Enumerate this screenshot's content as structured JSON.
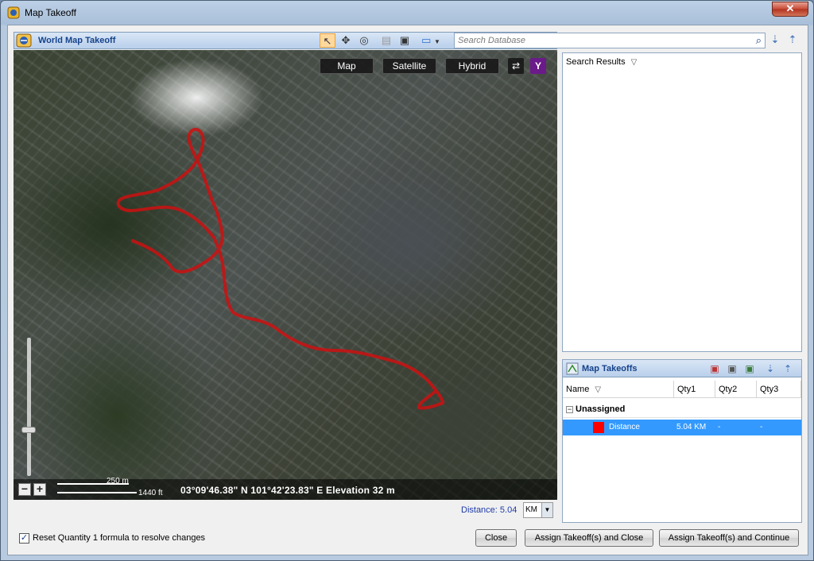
{
  "window": {
    "title": "Map Takeoff",
    "close_glyph": "✕"
  },
  "left_header": {
    "title": "World Map Takeoff"
  },
  "search": {
    "placeholder": "Search Database"
  },
  "map": {
    "view_buttons": [
      "Map",
      "Satellite",
      "Hybrid"
    ],
    "coordinates": "03°09'46.38\" N  101°42'23.83\" E  Elevation 32 m",
    "scale_meters": "250 m",
    "scale_feet": "1440 ft",
    "zoom_in": "+",
    "zoom_out": "−",
    "route_color": "#cc1111"
  },
  "distance": {
    "label": "Distance: 5.04",
    "unit": "KM"
  },
  "search_results": {
    "title": "Search Results"
  },
  "takeoffs": {
    "title": "Map Takeoffs",
    "columns": [
      "Name",
      "Qty1",
      "Qty2",
      "Qty3"
    ],
    "group": "Unassigned",
    "rows": [
      {
        "name": "Distance",
        "qty1": "5.04 KM",
        "qty2": "-",
        "qty3": "-",
        "color": "#ff0000"
      }
    ]
  },
  "footer": {
    "checkbox_label": "Reset Quantity 1 formula to resolve changes",
    "checkbox_checked": true,
    "buttons": [
      "Close",
      "Assign Takeoff(s) and Close",
      "Assign Takeoff(s) and Continue"
    ]
  }
}
